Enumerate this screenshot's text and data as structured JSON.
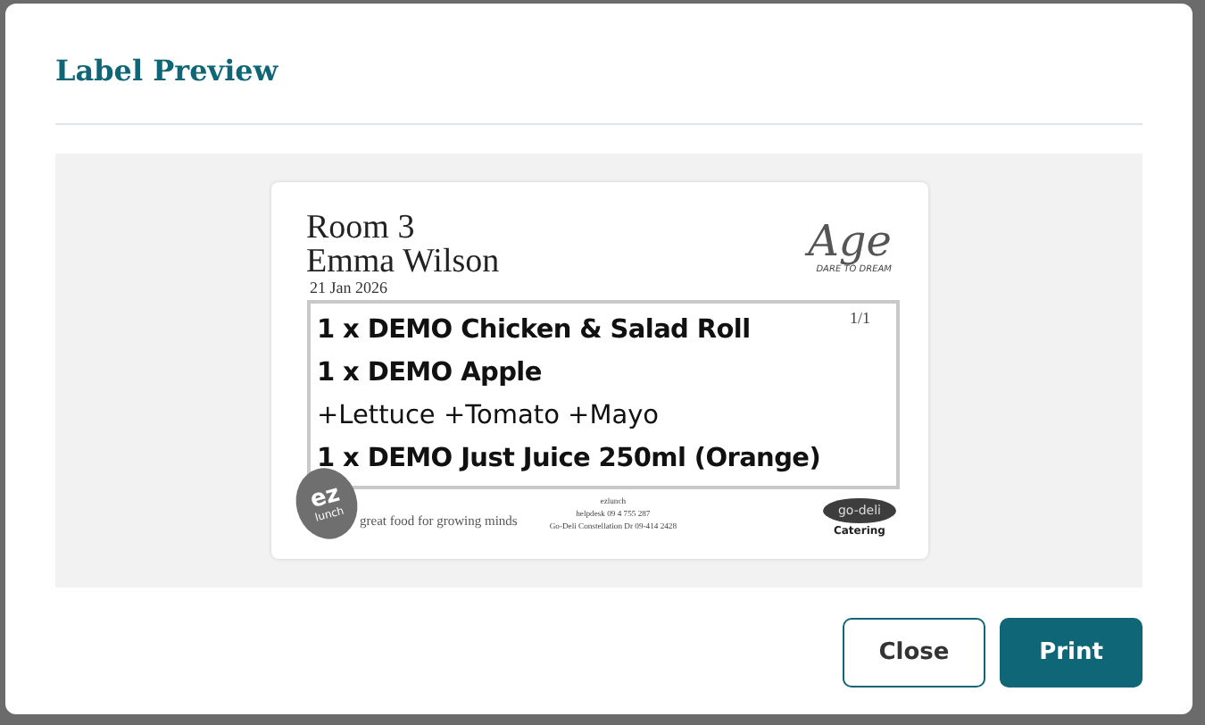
{
  "dialog": {
    "title": "Label Preview"
  },
  "label": {
    "room": "Room 3",
    "name": "Emma Wilson",
    "date": "21 Jan 2026",
    "page": "1/1",
    "logo_top": {
      "script": "Age",
      "tagline": "DARE TO DREAM"
    },
    "lines": [
      {
        "text": "1 x DEMO Chicken & Salad Roll",
        "kind": "item"
      },
      {
        "text": "1 x DEMO Apple",
        "kind": "item"
      },
      {
        "text": "+Lettuce +Tomato +Mayo",
        "kind": "modifier"
      },
      {
        "text": "1 x DEMO Just Juice 250ml (Orange)",
        "kind": "item"
      }
    ],
    "badge": {
      "top": "ez",
      "bottom": "lunch"
    },
    "slogan": "great food for growing minds",
    "contact": [
      "ezlunch",
      "helpdesk 09 4 755 287",
      "Go-Deli Constellation Dr 09-414 2428"
    ],
    "caterer": {
      "top": "go-deli",
      "bottom": "Catering"
    }
  },
  "buttons": [
    {
      "label": "Close",
      "kind": "secondary"
    },
    {
      "label": "Print",
      "kind": "primary"
    }
  ]
}
